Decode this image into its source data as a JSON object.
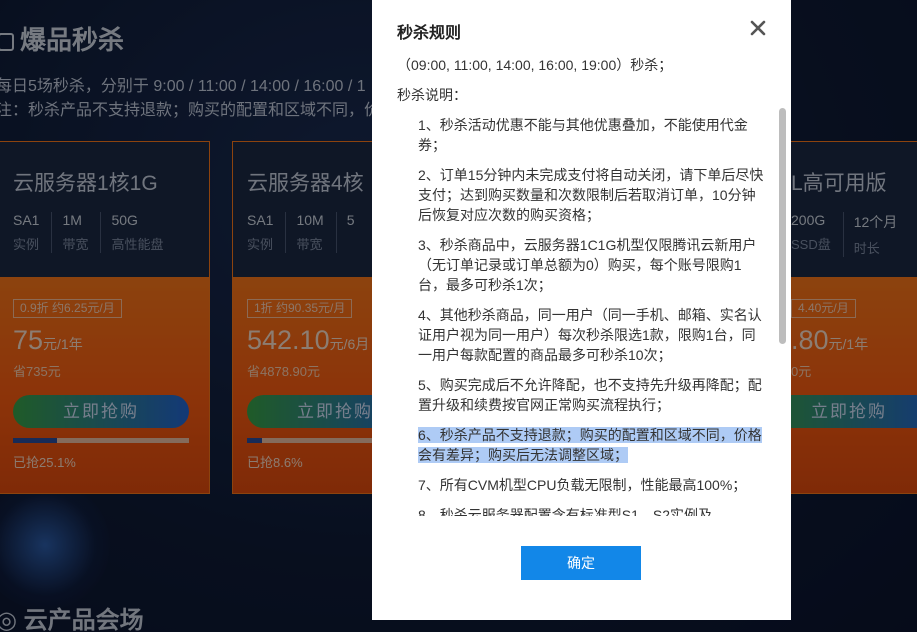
{
  "background": {
    "section_title": "爆品秒杀",
    "desc_line1": "每日5场秒杀，分别于 9:00 / 11:00 / 14:00 / 16:00 / 1",
    "desc_line2": "注：秒杀产品不支持退款；购买的配置和区域不同，价",
    "cards": [
      {
        "name": "云服务器1核1G",
        "specs": [
          {
            "value": "SA1",
            "label": "实例"
          },
          {
            "value": "1M",
            "label": "带宽"
          },
          {
            "value": "50G",
            "label": "高性能盘"
          }
        ],
        "badge": "0.9折  约6.25元/月",
        "price_num": "75",
        "price_unit": "元/1年",
        "save": "省735元",
        "buy_label": "立即抢购",
        "progress": 0.251,
        "sold": "已抢25.1%"
      },
      {
        "name": "云服务器4核",
        "specs": [
          {
            "value": "SA1",
            "label": "实例"
          },
          {
            "value": "10M",
            "label": "带宽"
          },
          {
            "value": "5",
            "label": ""
          }
        ],
        "badge": "1折  约90.35元/月",
        "price_num": "542.10",
        "price_unit": "元/6月",
        "save": "省4878.90元",
        "buy_label": "立即抢购",
        "progress": 0.086,
        "sold": "已抢8.6%"
      },
      {
        "name": "L高可用版",
        "specs": [
          {
            "value": "200G",
            "label": "SSD盘"
          },
          {
            "value": "12个月",
            "label": "时长"
          }
        ],
        "badge": "4.40元/月",
        "price_num": ".80",
        "price_unit": "元/1年",
        "save": "0元",
        "buy_label": "立即抢购",
        "progress": 0,
        "sold": ""
      }
    ],
    "bottom_title": "云产品会场"
  },
  "modal": {
    "title": "秒杀规则",
    "close_icon": "close-icon",
    "intro_line": "（09:00, 11:00, 14:00, 16:00, 19:00）秒杀；",
    "section_label": "秒杀说明：",
    "rules": [
      "1、秒杀活动优惠不能与其他优惠叠加，不能使用代金券；",
      "2、订单15分钟内未完成支付将自动关闭，请下单后尽快支付；达到购买数量和次数限制后若取消订单，10分钟后恢复对应次数的购买资格；",
      "3、秒杀商品中，云服务器1C1G机型仅限腾讯云新用户（无订单记录或订单总额为0）购买，每个账号限购1台，最多可秒杀1次；",
      "4、其他秒杀商品，同一用户（同一手机、邮箱、实名认证用户视为同一用户）每次秒杀限选1款，限购1台，同一用户每款配置的商品最多可秒杀10次；",
      "5、购买完成后不允许降配，也不支持先升级再降配；配置升级和续费按官网正常购买流程执行；",
      "6、秒杀产品不支持退款；购买的配置和区域不同，价格会有差异；购买后无法调整区域；",
      "7、所有CVM机型CPU负载无限制，性能最高100%；",
      "8、秒杀云服务器配置含有标准型S1、S2实例及"
    ],
    "highlighted_rule_index": 5,
    "confirm_label": "确定"
  },
  "colors": {
    "primary_button": "#1287e8",
    "card_accent": "#ff7a1a",
    "highlight": "#aecbf5"
  }
}
